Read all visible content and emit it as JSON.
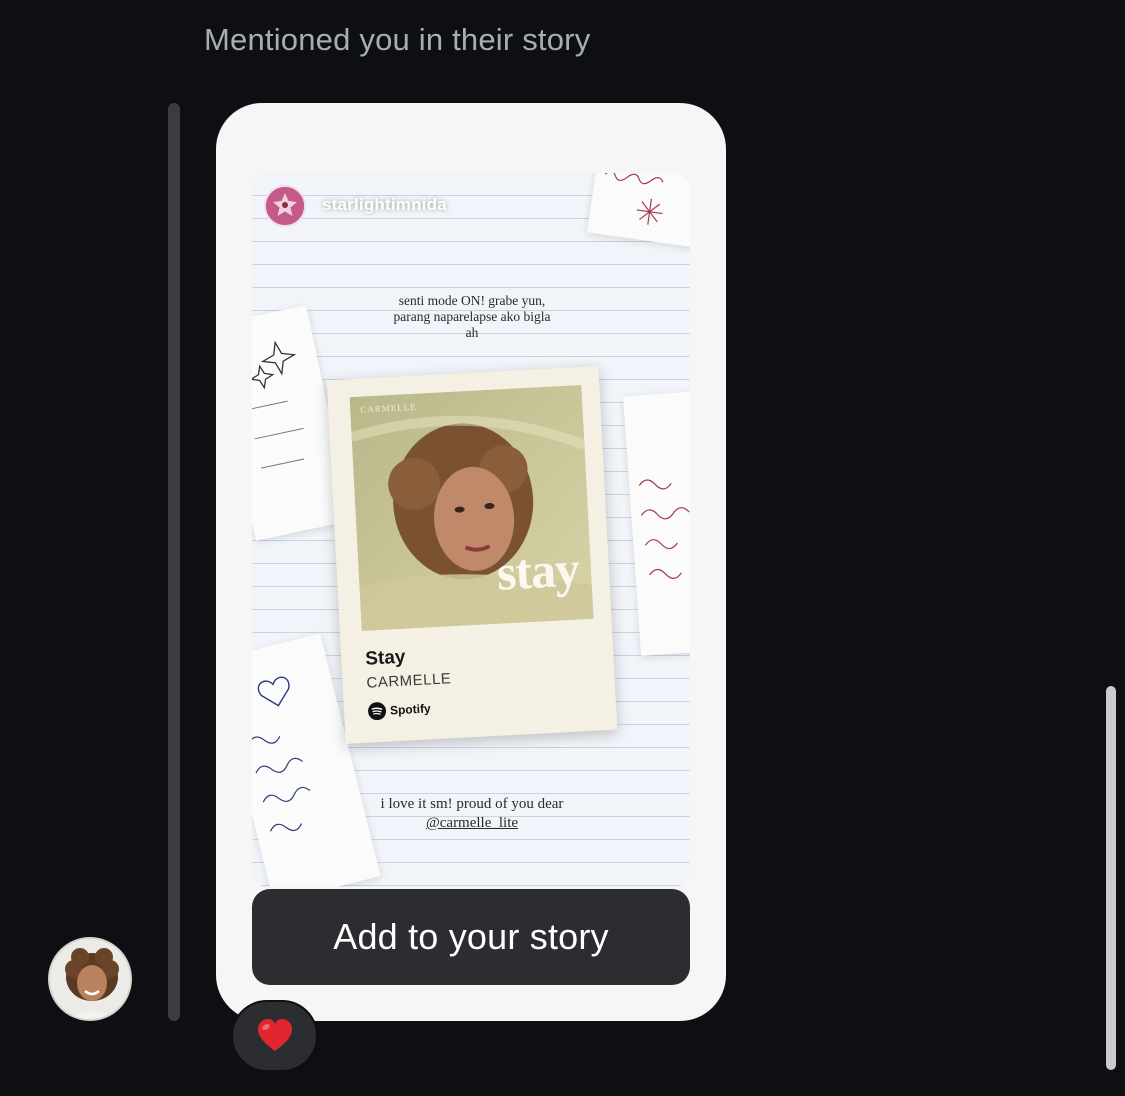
{
  "message": {
    "mention_label": "Mentioned you in their story",
    "reaction": "heart-emoji"
  },
  "story": {
    "username": "starlightimnida",
    "caption_top": "senti mode ON! grabe yun, parang naparelapse ako bigla ah",
    "caption_bottom_prefix": "i love it sm! proud of you dear",
    "mention_handle": "@carmelle_lite",
    "song": {
      "art_artist_label": "CARMELLE",
      "art_title": "stay",
      "title": "Stay",
      "artist": "CARMELLE",
      "platform": "Spotify"
    }
  },
  "actions": {
    "add_to_story": "Add to your story"
  },
  "colors": {
    "background": "#0d0f13",
    "card": "#f6f6f7",
    "button": "#2b2d31",
    "muted_text": "#a8acb3",
    "heart": "#e0262e"
  }
}
